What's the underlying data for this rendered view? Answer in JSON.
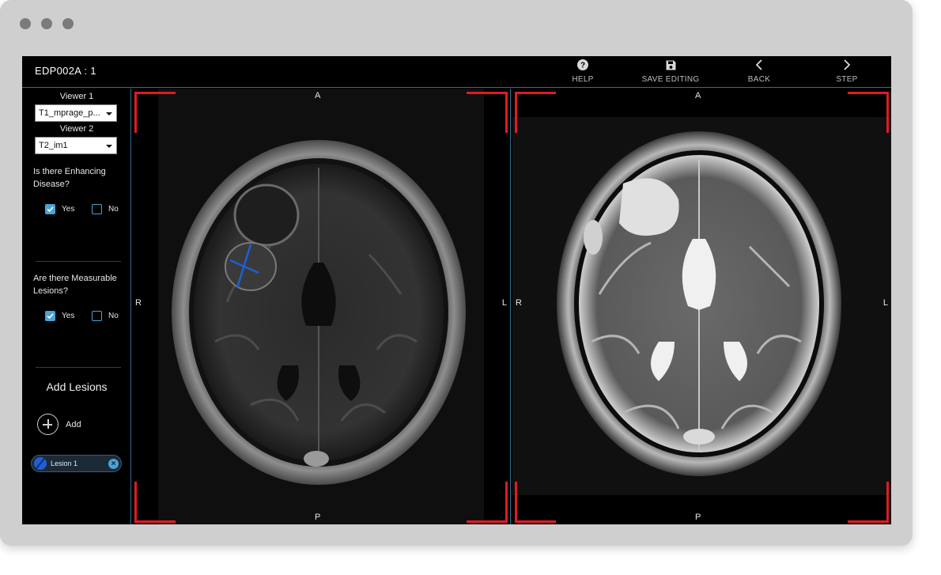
{
  "app": {
    "title": "EDP002A : 1"
  },
  "toolbar": {
    "help_label": "HELP",
    "save_label": "SAVE EDITING",
    "back_label": "BACK",
    "step_label": "STEP"
  },
  "sidebar": {
    "viewer1": {
      "label": "Viewer 1",
      "selected": "T1_mprage_p..."
    },
    "viewer2": {
      "label": "Viewer 2",
      "selected": "T2_im1"
    },
    "enhancing": {
      "question": "Is there Enhancing Disease?",
      "yes_label": "Yes",
      "no_label": "No",
      "yes_checked": true,
      "no_checked": false
    },
    "measurable": {
      "question": "Are there Measurable Lesions?",
      "yes_label": "Yes",
      "no_label": "No",
      "yes_checked": true,
      "no_checked": false
    },
    "add_lesions": {
      "title": "Add Lesions",
      "add_label": "Add"
    },
    "lesions": [
      {
        "label": "Lesion 1"
      }
    ]
  },
  "viewers": {
    "orientation": {
      "top": "A",
      "bottom": "P",
      "left": "R",
      "right": "L"
    }
  },
  "colors": {
    "accent": "#4aa3d6",
    "frame_marker": "#e01b24",
    "measure_line": "#1f5fd6",
    "panel_border": "#2f6e8f"
  }
}
